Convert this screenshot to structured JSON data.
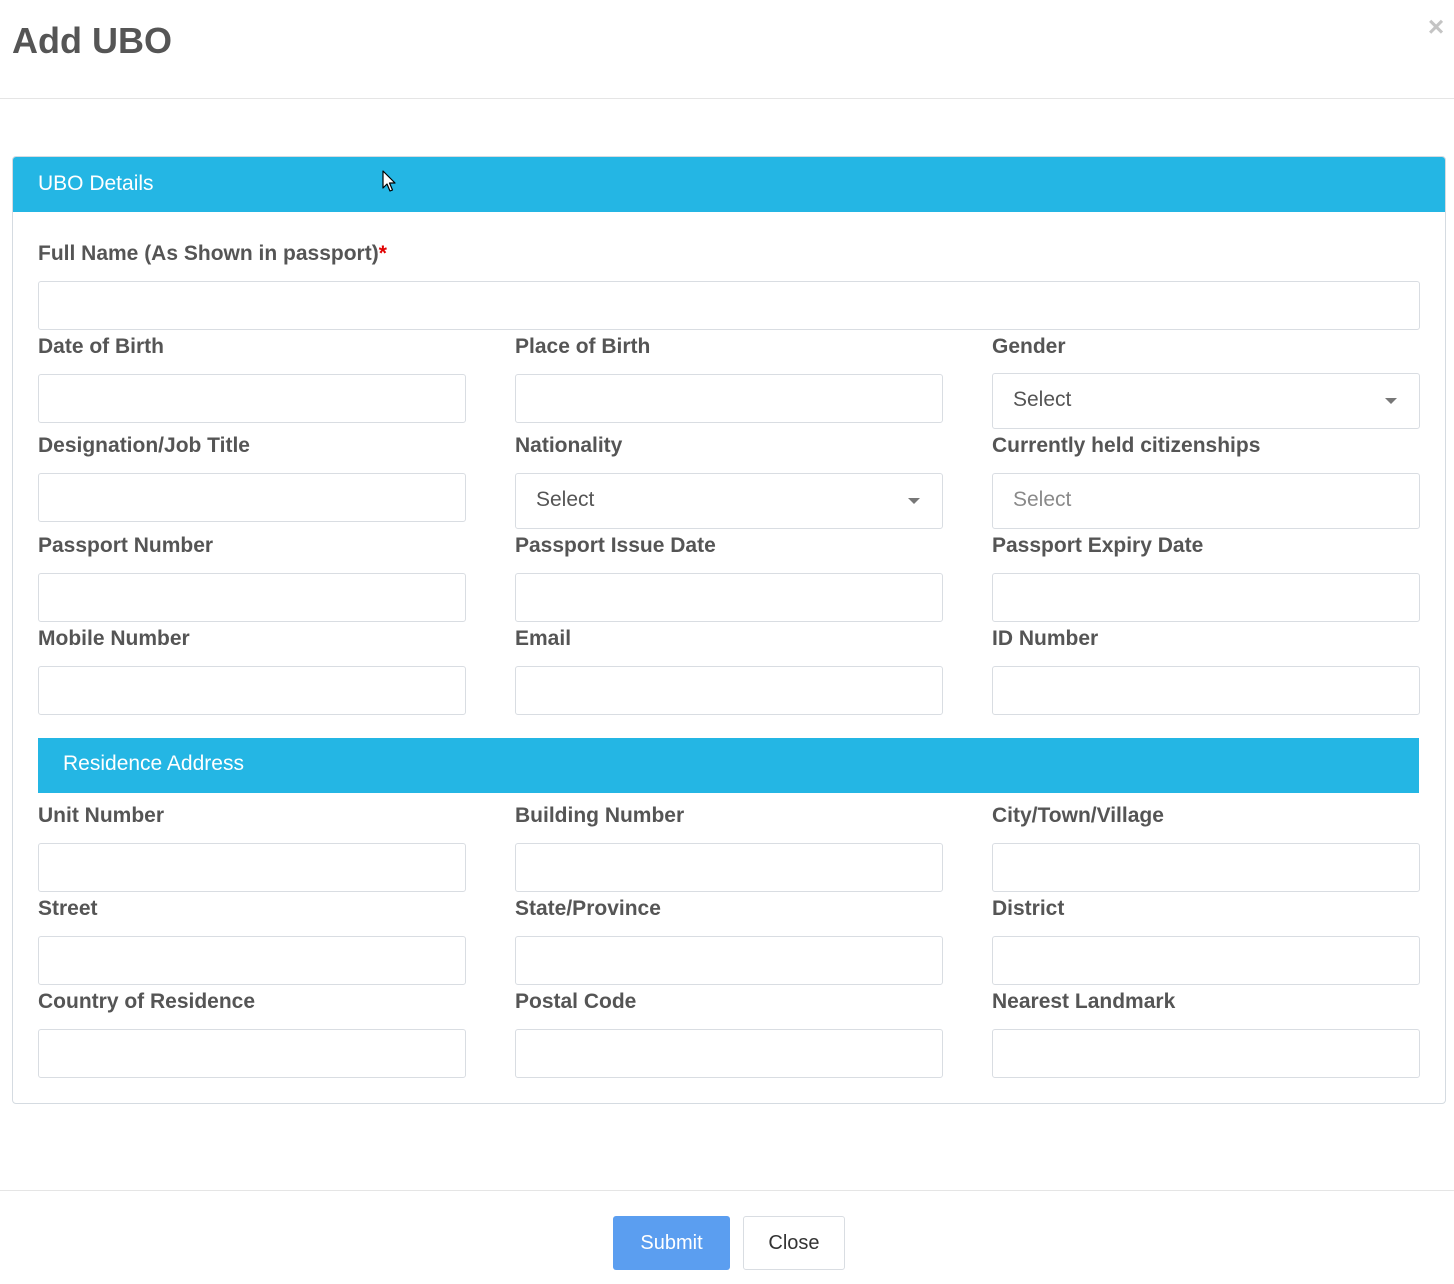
{
  "modal": {
    "title": "Add UBO",
    "close_glyph": "×"
  },
  "ubo_details": {
    "heading": "UBO Details",
    "full_name": {
      "label": "Full Name (As Shown in passport)",
      "required_mark": "*",
      "value": ""
    },
    "date_of_birth": {
      "label": "Date of Birth",
      "value": ""
    },
    "place_of_birth": {
      "label": "Place of Birth",
      "value": ""
    },
    "gender": {
      "label": "Gender",
      "selected": "Select"
    },
    "designation": {
      "label": "Designation/Job Title",
      "value": ""
    },
    "nationality": {
      "label": "Nationality",
      "selected": "Select"
    },
    "citizenships": {
      "label": "Currently held citizenships",
      "placeholder": "Select"
    },
    "passport_number": {
      "label": "Passport Number",
      "value": ""
    },
    "passport_issue_date": {
      "label": "Passport Issue Date",
      "value": ""
    },
    "passport_expiry_date": {
      "label": "Passport Expiry Date",
      "value": ""
    },
    "mobile_number": {
      "label": "Mobile Number",
      "value": ""
    },
    "email": {
      "label": "Email",
      "value": ""
    },
    "id_number": {
      "label": "ID Number",
      "value": ""
    }
  },
  "residence_address": {
    "heading": "Residence Address",
    "unit_number": {
      "label": "Unit Number",
      "value": ""
    },
    "building_number": {
      "label": "Building Number",
      "value": ""
    },
    "city": {
      "label": "City/Town/Village",
      "value": ""
    },
    "street": {
      "label": "Street",
      "value": ""
    },
    "state": {
      "label": "State/Province",
      "value": ""
    },
    "district": {
      "label": "District",
      "value": ""
    },
    "country": {
      "label": "Country of Residence",
      "value": ""
    },
    "postal_code": {
      "label": "Postal Code",
      "value": ""
    },
    "landmark": {
      "label": "Nearest Landmark",
      "value": ""
    }
  },
  "footer": {
    "submit_label": "Submit",
    "close_label": "Close"
  },
  "colors": {
    "accent": "#24b6e4",
    "submit": "#5b9ef0",
    "required": "#e00000"
  }
}
